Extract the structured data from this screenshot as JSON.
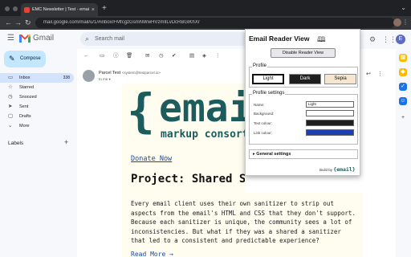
{
  "browser": {
    "tab_title": "EMC Newsletter | Test - email@...",
    "tab_close": "×",
    "new_tab": "+",
    "url": "mail.google.com/mail/u/1/#inbox/FMfcgzGsmNWwHVzmIlLvDcRBGlKhXr",
    "back": "←",
    "forward": "→",
    "reload": "↻",
    "menu": "⋮",
    "tab_menu": "⌄"
  },
  "gmail": {
    "logo_text": "Gmail",
    "search_placeholder": "Search mail",
    "avatar_letter": "E",
    "compose_label": "Compose",
    "nav": [
      {
        "label": "Inbox",
        "count": "338",
        "icon": "▭"
      },
      {
        "label": "Starred",
        "count": "",
        "icon": "☆"
      },
      {
        "label": "Snoozed",
        "count": "",
        "icon": "◷"
      },
      {
        "label": "Sent",
        "count": "",
        "icon": "➤"
      },
      {
        "label": "Drafts",
        "count": "",
        "icon": "▢"
      },
      {
        "label": "More",
        "count": "",
        "icon": "⌄"
      }
    ],
    "labels_heading": "Labels",
    "labels_add": "+"
  },
  "email": {
    "sender_name": "Parcel Test",
    "sender_email": "<system@testparcel.io>",
    "to_me": "to me ▾",
    "logo_brace": "{",
    "logo_word": "email",
    "logo_sub": "markup consortium",
    "donate": "Donate Now",
    "title": "Project: Shared Sanitizer",
    "paragraph": "Every email client uses their own sanitizer to strip out aspects from the email's HTML and CSS that they don't support. Because each sanitizer is unique, the community sees a lot of inconsistencies. But what if they was a shared a sanitizer that led to a consistent and predictable experience?",
    "read_more": "Read More →"
  },
  "popup": {
    "title": "Email Reader View",
    "disable_button": "Disable Reader View",
    "profile_legend": "Profile",
    "profiles": [
      {
        "label": "Light",
        "bg": "#ffffff",
        "fg": "#111111",
        "selected": true
      },
      {
        "label": "Dark",
        "bg": "#1f1f1f",
        "fg": "#ffffff",
        "selected": false
      },
      {
        "label": "Sepia",
        "bg": "#f6e6cf",
        "fg": "#111111",
        "selected": false
      }
    ],
    "settings_legend": "Profile settings",
    "settings": [
      {
        "label": "Name:",
        "value": "Light",
        "color": "#ffffff"
      },
      {
        "label": "Background:",
        "value": "",
        "color": "#ffffff"
      },
      {
        "label": "Text colour:",
        "value": "",
        "color": "#1f1f1f"
      },
      {
        "label": "Link colour:",
        "value": "",
        "color": "#1e3fae"
      }
    ],
    "general_settings": "▸ General settings",
    "built_by": "Build by",
    "built_by_logo": "{email}"
  },
  "colors": {
    "accent": "#1a73e8",
    "brand_teal": "#1d5c5c",
    "link": "#1a4aa6",
    "inbox_active_bg": "#d3e3fd",
    "compose_bg": "#c2e7ff"
  }
}
